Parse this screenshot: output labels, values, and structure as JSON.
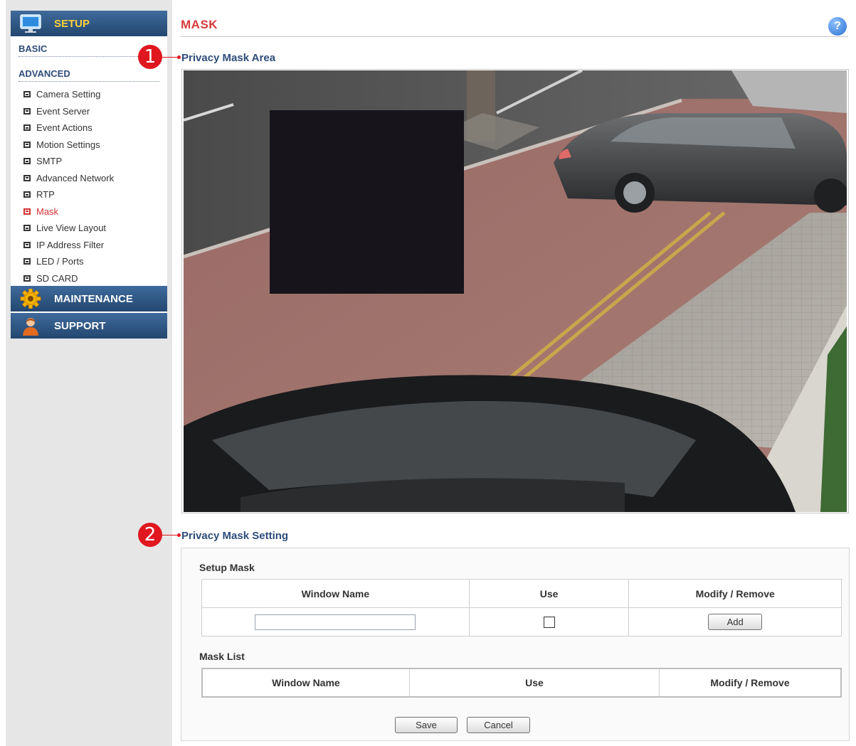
{
  "sidebar": {
    "setup_label": "SETUP",
    "basic_label": "BASIC",
    "advanced_label": "ADVANCED",
    "items": [
      {
        "label": "Camera Setting"
      },
      {
        "label": "Event Server"
      },
      {
        "label": "Event Actions"
      },
      {
        "label": "Motion Settings"
      },
      {
        "label": "SMTP"
      },
      {
        "label": "Advanced Network"
      },
      {
        "label": "RTP"
      },
      {
        "label": "Mask",
        "active": true
      },
      {
        "label": "Live View Layout"
      },
      {
        "label": "IP Address Filter"
      },
      {
        "label": "LED / Ports"
      },
      {
        "label": "SD CARD"
      }
    ],
    "maintenance_label": "MAINTENANCE",
    "support_label": "SUPPORT"
  },
  "callouts": {
    "one": "1",
    "two": "2"
  },
  "header": {
    "title": "MASK",
    "help_glyph": "?"
  },
  "privacy_area": {
    "title": "Privacy Mask Area"
  },
  "privacy_setting": {
    "title": "Privacy Mask Setting",
    "setup_mask": {
      "label": "Setup Mask",
      "columns": [
        "Window Name",
        "Use",
        "Modify / Remove"
      ],
      "window_name_value": "",
      "use_checked": false,
      "add_label": "Add"
    },
    "mask_list": {
      "label": "Mask List",
      "columns": [
        "Window Name",
        "Use",
        "Modify / Remove"
      ]
    },
    "save_label": "Save",
    "cancel_label": "Cancel"
  },
  "colors": {
    "accent_red": "#d83a3a",
    "nav_blue": "#23476f",
    "setup_yellow": "#ffd23a",
    "callout_red": "#e0171f"
  }
}
